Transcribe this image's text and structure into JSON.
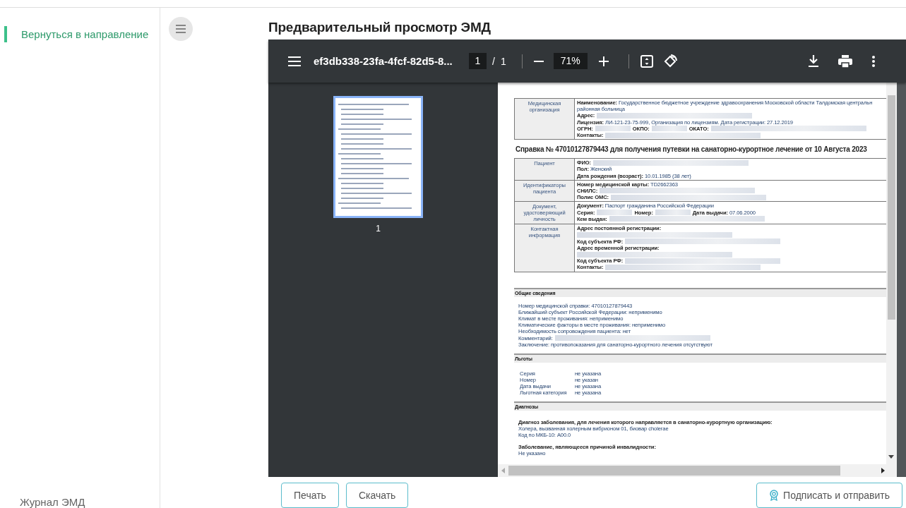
{
  "sidebar": {
    "items": [
      {
        "label": "Вернуться в направление",
        "selected": true
      }
    ],
    "footer": "Журнал ЭМД"
  },
  "title": "Предварительный просмотр ЭМД",
  "viewer": {
    "file_name": "ef3db338-23fa-4fcf-82d5-8...",
    "page": "1",
    "page_separator": "/",
    "page_count": "1",
    "zoom": "71%",
    "thumbnails": [
      {
        "label": "1",
        "selected": true
      }
    ],
    "document": [
      {
        "kind": "table",
        "rows": [
          {
            "header": "Медицинская организация",
            "lines": [
              [
                {
                  "kind": "text",
                  "text": "**Наименование:** Государственное бюджетное учреждение здравоохранения Московской области Талдомская центральн"
                }
              ],
              [
                {
                  "kind": "text",
                  "text": "районная больница"
                }
              ],
              [
                {
                  "kind": "text",
                  "text": "**Адрес:**"
                },
                {
                  "kind": "redacted"
                }
              ],
              [
                {
                  "kind": "text",
                  "text": "**Лицензия:** ЛИ-121-23-75-999, Организация по лицензиям. Дата регистрации: 27.12.2019"
                }
              ],
              [
                {
                  "kind": "text",
                  "text": "**ОГРН:**"
                },
                {
                  "kind": "redacted"
                },
                {
                  "kind": "text",
                  "text": "**ОКПО:**"
                },
                {
                  "kind": "redacted"
                },
                {
                  "kind": "text",
                  "text": "**ОКАТО:**"
                },
                {
                  "kind": "redacted"
                }
              ],
              [
                {
                  "kind": "text",
                  "text": "**Контакты:**"
                },
                {
                  "kind": "redacted"
                }
              ]
            ]
          }
        ]
      },
      {
        "kind": "heading",
        "text": "Справка № 47010127879443 для получения путевки на санаторно-курортное лечение от 10 Августа 2023"
      },
      {
        "kind": "table",
        "rows": [
          {
            "header": "Пациент",
            "lines": [
              [
                {
                  "kind": "text",
                  "text": "**ФИО:**"
                },
                {
                  "kind": "redacted"
                }
              ],
              [
                {
                  "kind": "text",
                  "text": "**Пол:** Женский"
                }
              ],
              [
                {
                  "kind": "text",
                  "text": "**Дата рождения (возраст):** 10.01.1985 (38 лет)"
                }
              ]
            ]
          },
          {
            "header": "Идентификаторы пациента",
            "lines": [
              [
                {
                  "kind": "text",
                  "text": "**Номер медицинской карты:** TD2662363"
                }
              ],
              [
                {
                  "kind": "text",
                  "text": "**СНИЛС:**"
                },
                {
                  "kind": "redacted"
                }
              ],
              [
                {
                  "kind": "text",
                  "text": "**Полис ОМС:**"
                },
                {
                  "kind": "redacted"
                }
              ]
            ]
          },
          {
            "header": "Документ, удостоверяющий личность",
            "lines": [
              [
                {
                  "kind": "text",
                  "text": "**Документ:** Паспорт гражданина Российской Федерации"
                }
              ],
              [
                {
                  "kind": "text",
                  "text": "**Серия:**"
                },
                {
                  "kind": "redacted"
                },
                {
                  "kind": "text",
                  "text": "**Номер:**"
                },
                {
                  "kind": "redacted"
                },
                {
                  "kind": "text",
                  "text": "**Дата выдачи:** 07.06.2000"
                }
              ],
              [
                {
                  "kind": "text",
                  "text": "**Кем выдан:**"
                },
                {
                  "kind": "redacted"
                }
              ]
            ]
          },
          {
            "header": "Контактная информация",
            "lines": [
              [
                {
                  "kind": "text",
                  "text": "**Адрес постоянной регистрации:**"
                }
              ],
              [
                {
                  "kind": "redacted"
                }
              ],
              [
                {
                  "kind": "text",
                  "text": "**Код субъекта РФ:**"
                },
                {
                  "kind": "redacted"
                }
              ],
              [
                {
                  "kind": "text",
                  "text": "**Адрес временной регистрации:**"
                }
              ],
              [
                {
                  "kind": "redacted"
                }
              ],
              [
                {
                  "kind": "text",
                  "text": "**Код субъекта РФ:**"
                },
                {
                  "kind": "redacted"
                }
              ],
              [
                {
                  "kind": "text",
                  "text": "**Контакты:**"
                },
                {
                  "kind": "redacted"
                }
              ]
            ]
          }
        ]
      },
      {
        "kind": "list",
        "title": "Общие сведения",
        "lines": [
          [
            {
              "kind": "text",
              "text": "Номер медицинской справки: 47010127879443"
            }
          ],
          [
            {
              "kind": "text",
              "text": "Ближайший субъект Российской Федерации: неприменимо"
            }
          ],
          [
            {
              "kind": "text",
              "text": "Климат в месте проживания: неприменимо"
            }
          ],
          [
            {
              "kind": "text",
              "text": "Климатические факторы в месте проживания: неприменимо"
            }
          ],
          [
            {
              "kind": "text",
              "text": "Необходимость сопровождения пациента: нет"
            }
          ],
          [
            {
              "kind": "text",
              "text": "Комментарий:"
            },
            {
              "kind": "redacted"
            }
          ],
          [
            {
              "kind": "text",
              "text": "Заключение: противопоказания для санаторно-курортного лечения отсутствуют"
            }
          ]
        ]
      },
      {
        "kind": "pairs",
        "title": "Льготы",
        "pairs": [
          {
            "name": "Серия",
            "value": "не указана"
          },
          {
            "name": "Номер",
            "value": "не указан"
          },
          {
            "name": "Дата выдачи",
            "value": "не указана"
          },
          {
            "name": "Льготная категория",
            "value": "не указана"
          }
        ]
      },
      {
        "kind": "entries",
        "title": "Диагнозы",
        "entries": [
          {
            "label": "Диагноз заболевания, для лечения которого направляется в санаторно-курортную организацию:",
            "values": [
              "Холера, вызванная холерным вибрионом 01, биовар cholerae",
              "Код по МКБ-10: A00.0"
            ]
          },
          {
            "label": "Заболевание, являющееся причиной инвалидности:",
            "values": [
              "Не указано"
            ]
          }
        ]
      }
    ]
  },
  "buttons": [
    {
      "label": "Печать",
      "kind": "plain"
    },
    {
      "label": "Скачать",
      "kind": "plain"
    },
    {
      "label": "Подписать и отправить",
      "kind": "sign"
    }
  ]
}
